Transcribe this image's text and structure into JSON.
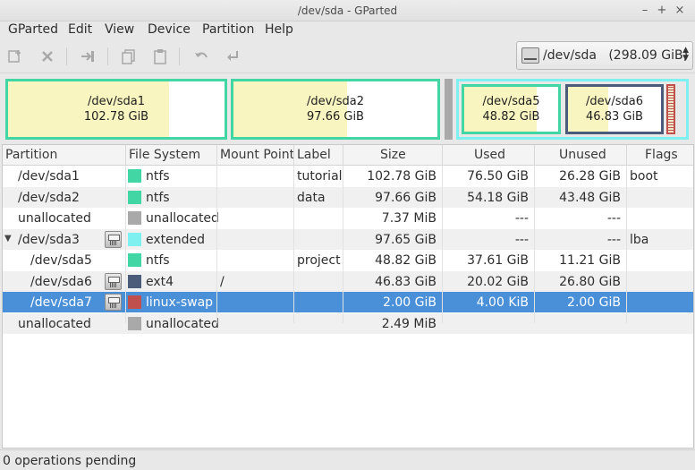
{
  "window": {
    "title": "/dev/sda - GParted",
    "minimize_glyph": "–",
    "maximize_glyph": "+",
    "close_glyph": "×"
  },
  "menu": [
    "GParted",
    "Edit",
    "View",
    "Device",
    "Partition",
    "Help"
  ],
  "toolbar": {
    "icons": [
      "new-partition-icon",
      "delete-icon",
      "resize-move-icon",
      "copy-icon",
      "paste-icon",
      "undo-icon",
      "apply-icon"
    ],
    "enabled": false
  },
  "device_selector": {
    "device": "/dev/sda",
    "size": "(298.09 GiB)",
    "icon": "harddisk-icon"
  },
  "disk_map": {
    "colors": {
      "ntfs": "#42d6a4",
      "ntfs_used": "#f8f5c0",
      "extended": "#7ef0f0",
      "ext4": "#4b5c7a",
      "linux_swap": "#c0504d",
      "unallocated": "#a9a9a9"
    },
    "sda1": {
      "name": "/dev/sda1",
      "size": "102.78 GiB",
      "used_fraction": 0.744
    },
    "sda2": {
      "name": "/dev/sda2",
      "size": "97.66 GiB",
      "used_fraction": 0.555
    },
    "sda5": {
      "name": "/dev/sda5",
      "size": "48.82 GiB",
      "used_fraction": 0.77
    },
    "sda6": {
      "name": "/dev/sda6",
      "size": "46.83 GiB",
      "used_fraction": 0.43
    }
  },
  "table": {
    "headers": [
      "Partition",
      "File System",
      "Mount Point",
      "Label",
      "Size",
      "Used",
      "Unused",
      "Flags"
    ],
    "rows": [
      {
        "partition": "/dev/sda1",
        "fs": "ntfs",
        "fs_color": "#42d6a4",
        "mount": "",
        "label": "tutorial",
        "size": "102.78 GiB",
        "used": "76.50 GiB",
        "unused": "26.28 GiB",
        "flags": "boot"
      },
      {
        "partition": "/dev/sda2",
        "fs": "ntfs",
        "fs_color": "#42d6a4",
        "mount": "",
        "label": "data",
        "size": "97.66 GiB",
        "used": "54.18 GiB",
        "unused": "43.48 GiB",
        "flags": ""
      },
      {
        "partition": "unallocated",
        "fs": "unallocated",
        "fs_color": "#a9a9a9",
        "mount": "",
        "label": "",
        "size": "7.37 MiB",
        "used": "---",
        "unused": "---",
        "flags": ""
      },
      {
        "partition": "/dev/sda3",
        "fs": "extended",
        "fs_color": "#7ef0f0",
        "mount": "",
        "label": "",
        "size": "97.65 GiB",
        "used": "---",
        "unused": "---",
        "flags": "lba",
        "expander": "▼",
        "locked": true
      },
      {
        "partition": "/dev/sda5",
        "fs": "ntfs",
        "fs_color": "#42d6a4",
        "mount": "",
        "label": "project",
        "size": "48.82 GiB",
        "used": "37.61 GiB",
        "unused": "11.21 GiB",
        "flags": ""
      },
      {
        "partition": "/dev/sda6",
        "fs": "ext4",
        "fs_color": "#4b5c7a",
        "mount": "/",
        "label": "",
        "size": "46.83 GiB",
        "used": "20.02 GiB",
        "unused": "26.80 GiB",
        "flags": "",
        "locked": true
      },
      {
        "partition": "/dev/sda7",
        "fs": "linux-swap",
        "fs_color": "#c0504d",
        "mount": "",
        "label": "",
        "size": "2.00 GiB",
        "used": "4.00 KiB",
        "unused": "2.00 GiB",
        "flags": "",
        "locked": true,
        "selected": true
      },
      {
        "partition": "unallocated",
        "fs": "unallocated",
        "fs_color": "#a9a9a9",
        "mount": "",
        "label": "",
        "size": "2.49 MiB",
        "used": "",
        "unused": "",
        "flags": ""
      }
    ]
  },
  "status": {
    "text": "0 operations pending"
  }
}
